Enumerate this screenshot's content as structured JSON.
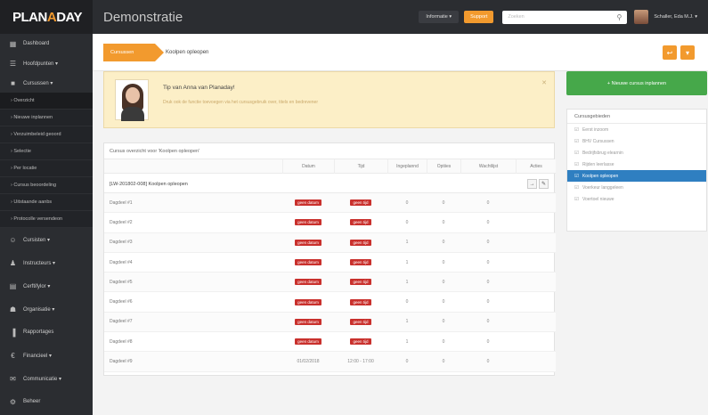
{
  "topbar": {
    "logo_main": "PLAN",
    "logo_accent": "A",
    "logo_tail": "DAY",
    "app_title": "Demonstratie",
    "info_dropdown": "Informatie ▾",
    "support_label": "Support",
    "search_placeholder": "Zoeken",
    "user_name": "Schaller, Eda M.J. ▾"
  },
  "sidebar": {
    "items_top": [
      {
        "icon": "dashboard-icon",
        "glyph": "▦",
        "label": "Dashboard"
      },
      {
        "icon": "list-icon",
        "glyph": "☰",
        "label": "Hoofdpunten ▾"
      },
      {
        "icon": "book-icon",
        "glyph": "■",
        "label": "Cursussen ▾"
      }
    ],
    "subitems": [
      {
        "label": "› Overzicht",
        "active": true
      },
      {
        "label": "› Nieuwe inplannen",
        "active": false
      },
      {
        "label": "› Verzuimbeleid geoord",
        "active": false
      },
      {
        "label": "› Selectie",
        "active": false
      },
      {
        "label": "› Per locatie",
        "active": false
      },
      {
        "label": "› Cursus beoordeling",
        "active": false
      },
      {
        "label": "› Uitstaande aanbs",
        "active": false
      },
      {
        "label": "› Protocolle versendeon",
        "active": false
      }
    ],
    "items_bottom": [
      {
        "icon": "users-icon",
        "glyph": "☺",
        "label": "Cursisten ▾"
      },
      {
        "icon": "person-icon",
        "glyph": "♟",
        "label": "Instructeurs ▾"
      },
      {
        "icon": "document-icon",
        "glyph": "▤",
        "label": "Cerftifylor ▾"
      },
      {
        "icon": "org-icon",
        "glyph": "☗",
        "label": "Organisatie ▾"
      },
      {
        "icon": "chart-icon",
        "glyph": "▐",
        "label": "Rapportages"
      },
      {
        "icon": "euro-icon",
        "glyph": "€",
        "label": "Financieel ▾"
      },
      {
        "icon": "mail-icon",
        "glyph": "✉",
        "label": "Communicatie ▾"
      },
      {
        "icon": "settings-icon",
        "glyph": "⚙",
        "label": "Beheer"
      }
    ]
  },
  "breadcrumb": {
    "home": "Cursussen",
    "current": "Koolpen opleopen"
  },
  "tip": {
    "title": "Tip van Anna van Planaday!",
    "text": "Druk ook de functie toevoegen via het cursusgebruik over, titels en bedrevener"
  },
  "panel": {
    "header": "Cursus overzicht voor 'Koolpen opleopen'",
    "columns": [
      "",
      "Datum",
      "Tijd",
      "Ingeplannd",
      "Optiies",
      "Wachtlijst",
      "Acties"
    ],
    "group_label": "[LW-201802-008] Koolpen opleopen",
    "rows": [
      {
        "name": "Dagdeel #1",
        "date": "geen datum",
        "time": "geen tijd",
        "a": "0",
        "b": "0",
        "c": "0"
      },
      {
        "name": "Dagdeel #2",
        "date": "geen datum",
        "time": "geen tijd",
        "a": "0",
        "b": "0",
        "c": "0"
      },
      {
        "name": "Dagdeel #3",
        "date": "geen datum",
        "time": "geen tijd",
        "a": "1",
        "b": "0",
        "c": "0"
      },
      {
        "name": "Dagdeel #4",
        "date": "geen datum",
        "time": "geen tijd",
        "a": "1",
        "b": "0",
        "c": "0"
      },
      {
        "name": "Dagdeel #5",
        "date": "geen datum",
        "time": "geen tijd",
        "a": "1",
        "b": "0",
        "c": "0"
      },
      {
        "name": "Dagdeel #6",
        "date": "geen datum",
        "time": "geen tijd",
        "a": "0",
        "b": "0",
        "c": "0"
      },
      {
        "name": "Dagdeel #7",
        "date": "geen datum",
        "time": "geen tijd",
        "a": "1",
        "b": "0",
        "c": "0"
      },
      {
        "name": "Dagdeel #8",
        "date": "geen datum",
        "time": "geen tijd",
        "a": "1",
        "b": "0",
        "c": "0"
      },
      {
        "name": "Dagdeel #9",
        "date": "01/02/2018",
        "time": "12:00 - 17:00",
        "a": "0",
        "b": "0",
        "c": "0"
      }
    ]
  },
  "right": {
    "new_button": "+ Nieuwe cursus inplannen",
    "cursus_header": "Cursusgebieden",
    "cursus_items": [
      {
        "label": "Eerst inzoom",
        "active": false
      },
      {
        "label": "BHV Cursussen",
        "active": false
      },
      {
        "label": "Bedrijfsbrug elearnin",
        "active": false
      },
      {
        "label": "Rijden leerlasse",
        "active": false
      },
      {
        "label": "Koolpen opleopen",
        "active": true
      },
      {
        "label": "Voerkeur langgeleen",
        "active": false
      },
      {
        "label": "Voertoel nieuwe",
        "active": false
      }
    ]
  },
  "colors": {
    "accent": "#f29a2e",
    "success": "#46a84a",
    "danger": "#c9302c",
    "selected": "#2f7fc1"
  }
}
